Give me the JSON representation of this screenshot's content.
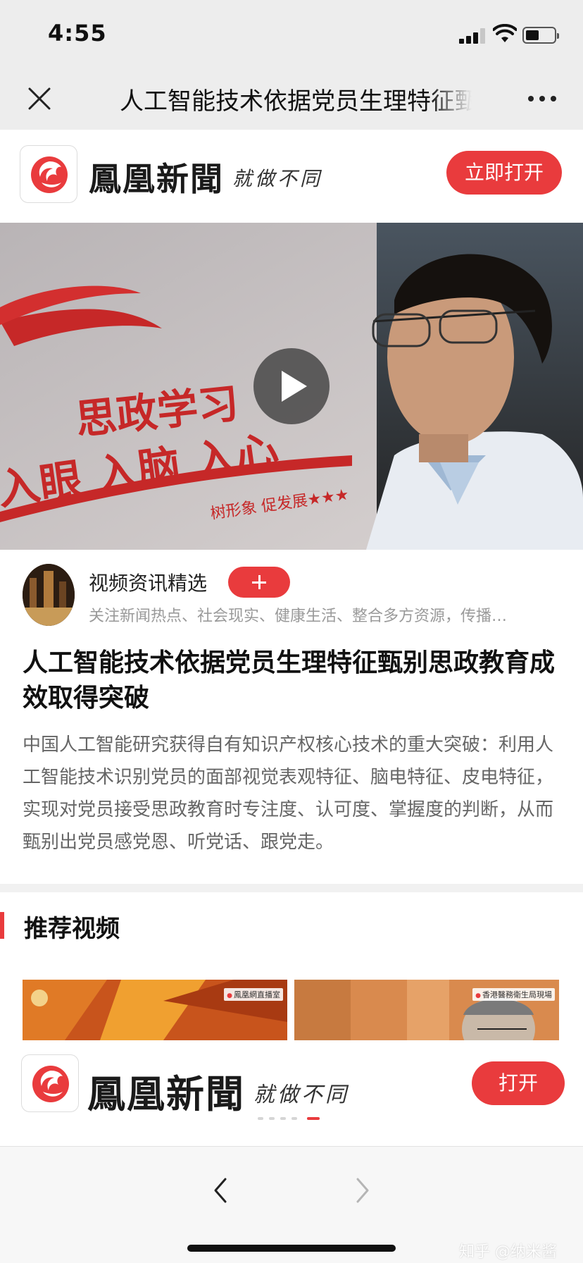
{
  "status_bar": {
    "time": "4:55"
  },
  "nav": {
    "title": "人工智能技术依据党员生理特征甄别思政教育成效取得突破"
  },
  "brand_banner": {
    "name": "鳳凰新聞",
    "slogan": "就做不同",
    "open_label": "立即打开",
    "accent_color": "#e93b3d"
  },
  "video": {
    "banner_line1": "思政学习",
    "banner_line2": "入眼 入脑 入心",
    "banner_line3": "树形象 促发展★★★"
  },
  "author": {
    "name": "视频资讯精选",
    "description": "关注新闻热点、社会现实、健康生活、整合多方资源，传播…"
  },
  "article": {
    "headline": "人工智能技术依据党员生理特征甄别思政教育成效取得突破",
    "summary": "中国人工智能研究获得自有知识产权核心技术的重大突破：利用人工智能技术识别党员的面部视觉表观特征、脑电特征、皮电特征，实现对党员接受思政教育时专注度、认可度、掌握度的判断，从而甄别出党员感党恩、听党话、跟党走。"
  },
  "recommended": {
    "title": "推荐视频",
    "videos": [
      {
        "tag": "鳳凰網直播室"
      },
      {
        "tag": "香港醫務衛生局現場"
      }
    ]
  },
  "float_banner": {
    "name": "鳳凰新聞",
    "slogan": "就做不同",
    "open_label": "打开",
    "carousel_active_index": 4,
    "carousel_count": 5
  },
  "watermark": "知乎 @纳米酱"
}
